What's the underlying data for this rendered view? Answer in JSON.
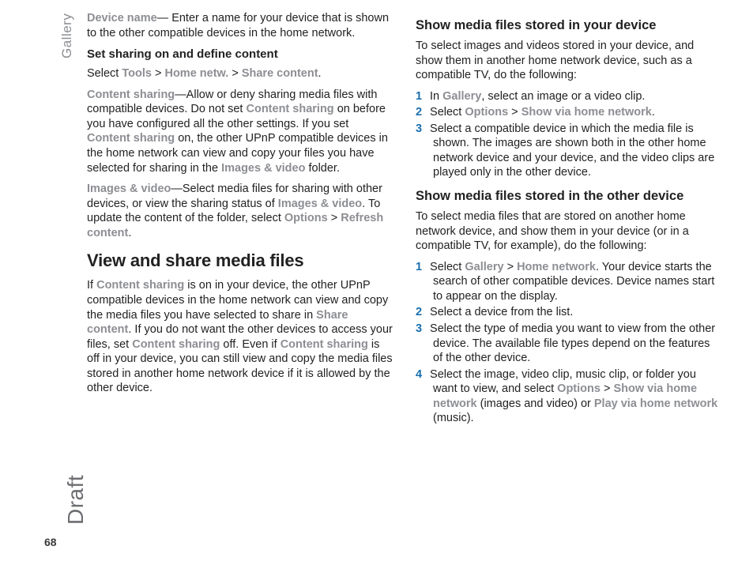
{
  "margin": {
    "section": "Gallery",
    "draft": "Draft",
    "page": "68"
  },
  "left": {
    "p1_term": "Device name",
    "p1_rest": "— Enter a name for your device that is shown to the other compatible devices in the home network.",
    "h_sub1": "Set sharing on and define content",
    "p2_a": "Select ",
    "p2_tools": "Tools",
    "p2_gt1": " > ",
    "p2_home": "Home netw.",
    "p2_gt2": " > ",
    "p2_share": "Share content",
    "p2_end": ".",
    "p3_term": "Content sharing",
    "p3_a": "—Allow or deny sharing media files with compatible devices. Do not set ",
    "p3_cs1": "Content sharing",
    "p3_b": " on before you have configured all the other settings. If you set ",
    "p3_cs2": "Content sharing",
    "p3_c": " on, the other UPnP compatible devices in the home network can view and copy your files you have selected for sharing in the ",
    "p3_iv": "Images & video",
    "p3_d": " folder.",
    "p4_term": "Images & video",
    "p4_a": "—Select media files for sharing with other devices, or view the sharing status of ",
    "p4_iv": "Images & video",
    "p4_b": ". To update the content of the folder, select ",
    "p4_opt": "Options",
    "p4_gt": " > ",
    "p4_ref": "Refresh content",
    "p4_end": ".",
    "h_main": "View and share media files",
    "p5_a": "If ",
    "p5_cs1": "Content sharing",
    "p5_b": " is on in your device, the other UPnP compatible devices in the home network can view and copy the media files you have selected to share in ",
    "p5_sc": "Share content",
    "p5_c": ". If you do not want the other devices to access your files, set ",
    "p5_cs2": "Content sharing",
    "p5_d": " off. Even if ",
    "p5_cs3": "Content sharing",
    "p5_e": " is off in your device, you can still view and copy the media files stored in another home network device if it is allowed by the other device."
  },
  "right": {
    "h_mid1": "Show media files stored in your device",
    "p1": "To select images and videos stored in your device, and show them in another home network device, such as a compatible TV, do the following:",
    "s1": {
      "n1": "1",
      "t1a": "In ",
      "t1g": "Gallery",
      "t1b": ", select an image or a video clip.",
      "n2": "2",
      "t2a": "Select ",
      "t2o": "Options",
      "t2gt": " > ",
      "t2s": "Show via home network",
      "t2end": ".",
      "n3": "3",
      "t3": "Select a compatible device in which the media file is shown. The images are shown both in the other home network device and your device, and the video clips are played only in the other device."
    },
    "h_mid2": "Show media files stored in the other device",
    "p2": "To select media files that are stored on another home network device, and show them in your device (or in a compatible TV, for example), do the following:",
    "s2": {
      "n1": "1",
      "t1a": "Select ",
      "t1g": "Gallery",
      "t1gt": " > ",
      "t1h": "Home network",
      "t1b": ". Your device starts the search of other compatible devices. Device names start to appear on the display.",
      "n2": "2",
      "t2": "Select a device from the list.",
      "n3": "3",
      "t3": "Select the type of media you want to view from the other device. The available file types depend on the features of the other device.",
      "n4": "4",
      "t4a": "Select the image, video clip, music clip, or folder you want to view, and select ",
      "t4o": "Options",
      "t4gt": " > ",
      "t4s": "Show via home network",
      "t4b": " (images and video) or ",
      "t4p": "Play via home network",
      "t4c": " (music)."
    }
  }
}
